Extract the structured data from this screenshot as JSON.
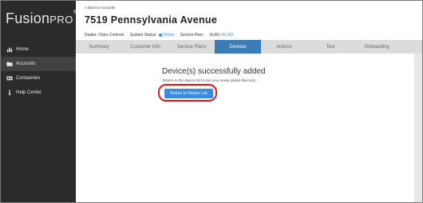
{
  "brand": {
    "name": "Fusion",
    "suffix": "PRO",
    "mark": "®"
  },
  "sidebar": {
    "items": [
      {
        "label": "Home",
        "icon": "bar-chart-icon",
        "active": false
      },
      {
        "label": "Accounts",
        "icon": "folder-icon",
        "active": true
      },
      {
        "label": "Companies",
        "icon": "id-card-icon",
        "active": false
      },
      {
        "label": "Help Center",
        "icon": "info-icon",
        "active": false
      }
    ]
  },
  "header": {
    "back_label": "< Back to Accounts",
    "title": "7519 Pennsylvania Avenue",
    "dealer_label": "Dealer:",
    "dealer_value": "Clare Controls",
    "status_label": "System Status:",
    "status_value": "Online",
    "service_plan_label": "Service Plan:",
    "service_plan_value": "",
    "uuid_label": "UUID:",
    "uuid_value": "AC:5D"
  },
  "tabs": [
    {
      "label": "Summary",
      "active": false
    },
    {
      "label": "Customer Info",
      "active": false
    },
    {
      "label": "Service Plans",
      "active": false
    },
    {
      "label": "Devices",
      "active": true
    },
    {
      "label": "Actions",
      "active": false
    },
    {
      "label": "Test",
      "active": false
    },
    {
      "label": "Onboarding",
      "active": false
    }
  ],
  "content": {
    "heading": "Device(s) successfully added",
    "subtext": "Return to the device list to see your newly added device(s).",
    "button_label": "Return to Device List"
  },
  "colors": {
    "sidebar": "#2b2b2b",
    "accent": "#3b7cb6",
    "button": "#3d8be1",
    "highlight": "#e01b1b",
    "online": "#3a8ee6"
  }
}
